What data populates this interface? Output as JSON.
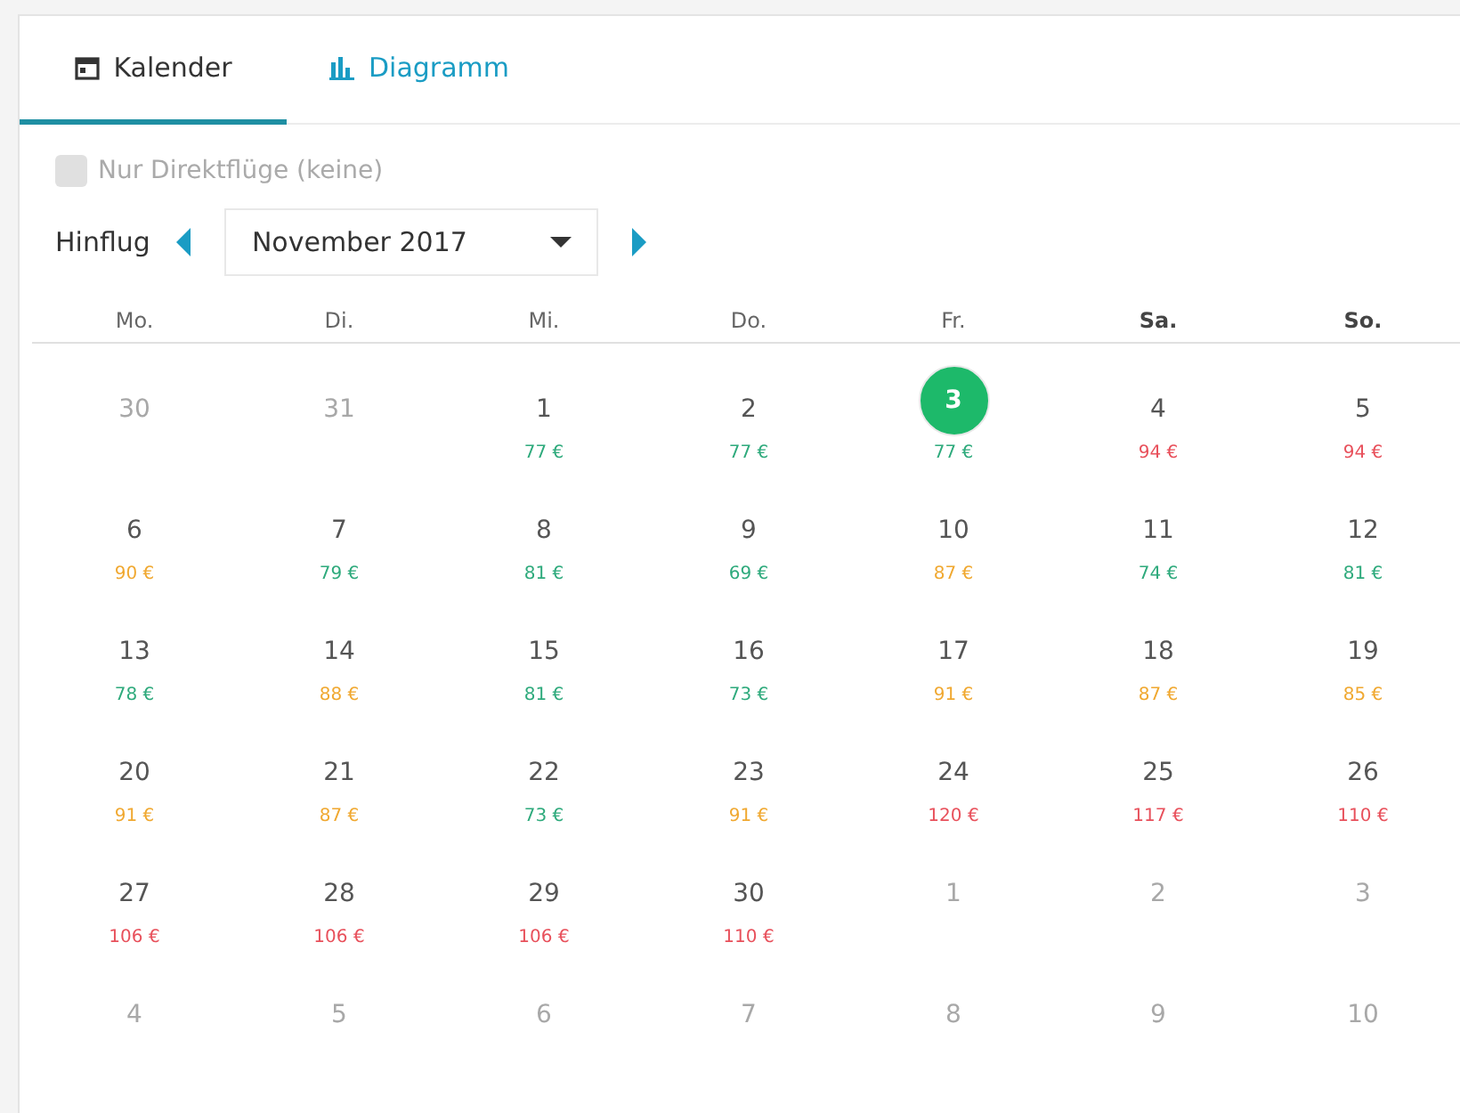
{
  "tabs": [
    {
      "label": "Kalender",
      "selected": true
    },
    {
      "label": "Diagramm",
      "selected": false
    }
  ],
  "direct_only": {
    "label": "Nur Direktflüge (keine)",
    "checked": false,
    "disabled": true
  },
  "outbound": {
    "label": "Hinflug",
    "month": "November 2017"
  },
  "weekdays": [
    {
      "label": "Mo.",
      "weekend": false
    },
    {
      "label": "Di.",
      "weekend": false
    },
    {
      "label": "Mi.",
      "weekend": false
    },
    {
      "label": "Do.",
      "weekend": false
    },
    {
      "label": "Fr.",
      "weekend": false
    },
    {
      "label": "Sa.",
      "weekend": true
    },
    {
      "label": "So.",
      "weekend": true
    }
  ],
  "weeks": [
    [
      {
        "day": "30",
        "muted": true,
        "selected": false
      },
      {
        "day": "31",
        "muted": true,
        "selected": false
      },
      {
        "day": "1",
        "price": "77 €",
        "color": "#2eaa7c",
        "muted": false,
        "selected": false
      },
      {
        "day": "2",
        "price": "77 €",
        "color": "#2eaa7c",
        "muted": false,
        "selected": false
      },
      {
        "day": "3",
        "price": "77 €",
        "color": "#2eaa7c",
        "muted": false,
        "selected": true
      },
      {
        "day": "4",
        "price": "94 €",
        "color": "#e8505b",
        "muted": false,
        "selected": false
      },
      {
        "day": "5",
        "price": "94 €",
        "color": "#e8505b",
        "muted": false,
        "selected": false
      }
    ],
    [
      {
        "day": "6",
        "price": "90 €",
        "color": "#f0a830",
        "muted": false,
        "selected": false
      },
      {
        "day": "7",
        "price": "79 €",
        "color": "#2eaa7c",
        "muted": false,
        "selected": false
      },
      {
        "day": "8",
        "price": "81 €",
        "color": "#2eaa7c",
        "muted": false,
        "selected": false
      },
      {
        "day": "9",
        "price": "69 €",
        "color": "#2eaa7c",
        "muted": false,
        "selected": false
      },
      {
        "day": "10",
        "price": "87 €",
        "color": "#f0a830",
        "muted": false,
        "selected": false
      },
      {
        "day": "11",
        "price": "74 €",
        "color": "#2eaa7c",
        "muted": false,
        "selected": false
      },
      {
        "day": "12",
        "price": "81 €",
        "color": "#2eaa7c",
        "muted": false,
        "selected": false
      }
    ],
    [
      {
        "day": "13",
        "price": "78 €",
        "color": "#2eaa7c",
        "muted": false,
        "selected": false
      },
      {
        "day": "14",
        "price": "88 €",
        "color": "#f0a830",
        "muted": false,
        "selected": false
      },
      {
        "day": "15",
        "price": "81 €",
        "color": "#2eaa7c",
        "muted": false,
        "selected": false
      },
      {
        "day": "16",
        "price": "73 €",
        "color": "#2eaa7c",
        "muted": false,
        "selected": false
      },
      {
        "day": "17",
        "price": "91 €",
        "color": "#f0a830",
        "muted": false,
        "selected": false
      },
      {
        "day": "18",
        "price": "87 €",
        "color": "#f0a830",
        "muted": false,
        "selected": false
      },
      {
        "day": "19",
        "price": "85 €",
        "color": "#f0a830",
        "muted": false,
        "selected": false
      }
    ],
    [
      {
        "day": "20",
        "price": "91 €",
        "color": "#f0a830",
        "muted": false,
        "selected": false
      },
      {
        "day": "21",
        "price": "87 €",
        "color": "#f0a830",
        "muted": false,
        "selected": false
      },
      {
        "day": "22",
        "price": "73 €",
        "color": "#2eaa7c",
        "muted": false,
        "selected": false
      },
      {
        "day": "23",
        "price": "91 €",
        "color": "#f0a830",
        "muted": false,
        "selected": false
      },
      {
        "day": "24",
        "price": "120 €",
        "color": "#e8505b",
        "muted": false,
        "selected": false
      },
      {
        "day": "25",
        "price": "117 €",
        "color": "#e8505b",
        "muted": false,
        "selected": false
      },
      {
        "day": "26",
        "price": "110 €",
        "color": "#e8505b",
        "muted": false,
        "selected": false
      }
    ],
    [
      {
        "day": "27",
        "price": "106 €",
        "color": "#e8505b",
        "muted": false,
        "selected": false
      },
      {
        "day": "28",
        "price": "106 €",
        "color": "#e8505b",
        "muted": false,
        "selected": false
      },
      {
        "day": "29",
        "price": "106 €",
        "color": "#e8505b",
        "muted": false,
        "selected": false
      },
      {
        "day": "30",
        "price": "110 €",
        "color": "#e8505b",
        "muted": false,
        "selected": false
      },
      {
        "day": "1",
        "muted": true,
        "selected": false
      },
      {
        "day": "2",
        "muted": true,
        "selected": false
      },
      {
        "day": "3",
        "muted": true,
        "selected": false
      }
    ],
    [
      {
        "day": "4",
        "muted": true,
        "selected": false
      },
      {
        "day": "5",
        "muted": true,
        "selected": false
      },
      {
        "day": "6",
        "muted": true,
        "selected": false
      },
      {
        "day": "7",
        "muted": true,
        "selected": false
      },
      {
        "day": "8",
        "muted": true,
        "selected": false
      },
      {
        "day": "9",
        "muted": true,
        "selected": false
      },
      {
        "day": "10",
        "muted": true,
        "selected": false
      }
    ]
  ]
}
